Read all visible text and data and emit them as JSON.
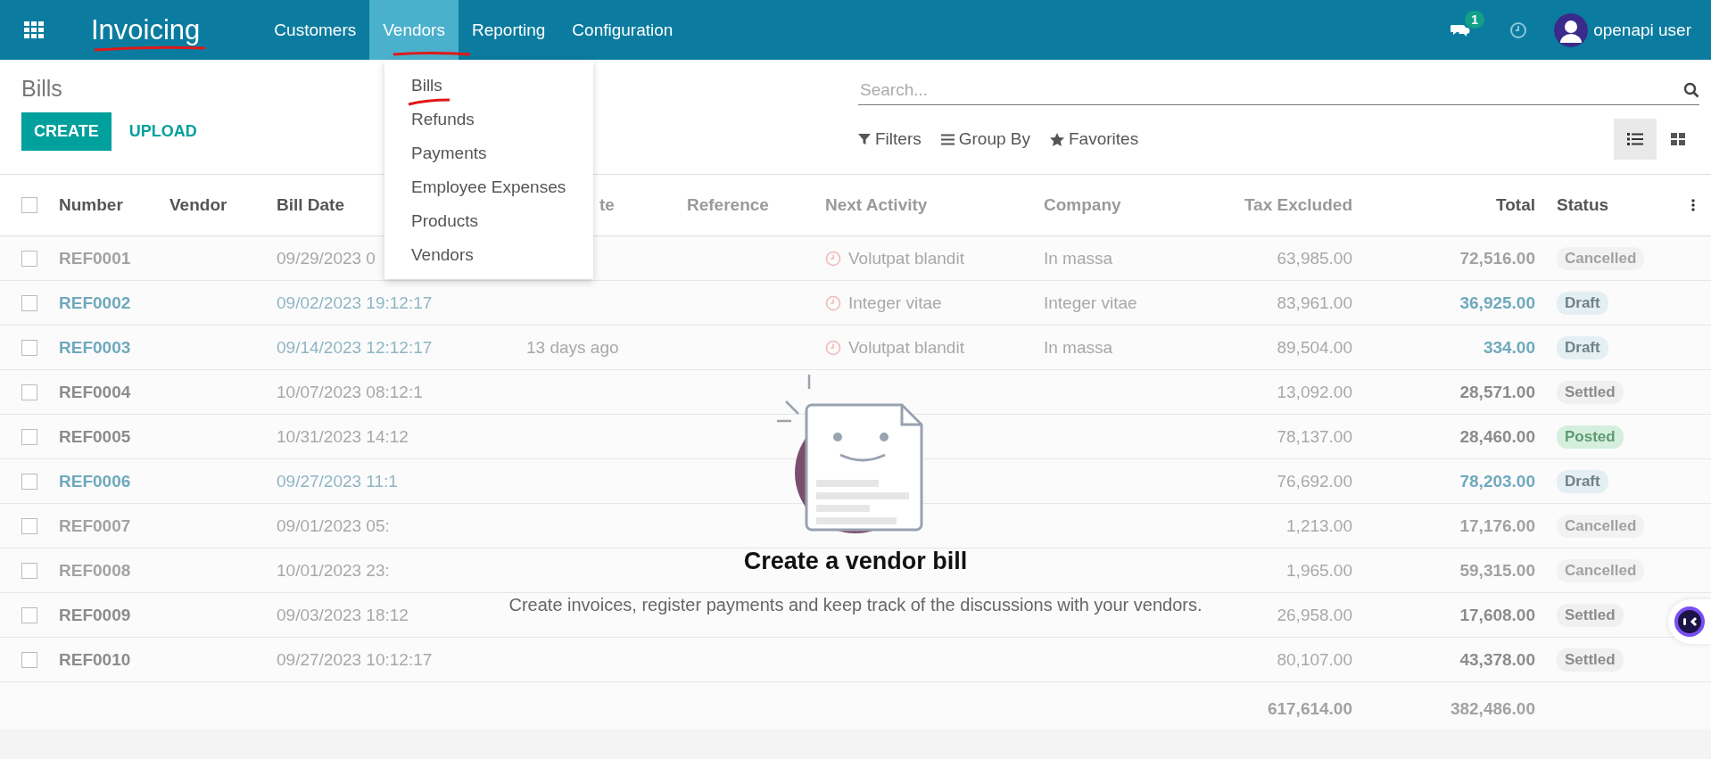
{
  "app": {
    "name": "Invoicing"
  },
  "menu": [
    {
      "label": "Customers",
      "selected": false
    },
    {
      "label": "Vendors",
      "selected": true
    },
    {
      "label": "Reporting",
      "selected": false
    },
    {
      "label": "Configuration",
      "selected": false
    }
  ],
  "user": {
    "messages_count": "1",
    "name": "openapi user"
  },
  "dropdown": [
    "Bills",
    "Refunds",
    "Payments",
    "Employee Expenses",
    "Products",
    "Vendors"
  ],
  "page": {
    "title": "Bills",
    "create": "CREATE",
    "upload": "UPLOAD"
  },
  "search": {
    "placeholder": "Search..."
  },
  "filters": [
    "Filters",
    "Group By",
    "Favorites"
  ],
  "views": [
    {
      "kind": "list",
      "selected": true
    },
    {
      "kind": "kanban",
      "selected": false
    }
  ],
  "table": {
    "select_all": {
      "checked": false
    },
    "columns": [
      "Number",
      "Vendor",
      "Bill Date",
      "te",
      "Reference",
      "Next Activity",
      "Company",
      "Tax Excluded",
      "Total",
      "Status"
    ],
    "rows": [
      {
        "checked": false,
        "number": "REF0001",
        "bill_date": "09/29/2023 0",
        "next_activity": "Volutpat blandit",
        "company": "In massa",
        "tax_excluded": "63,985.00",
        "total": "72,516.00",
        "status": "Cancelled",
        "kind": "cancelled"
      },
      {
        "checked": false,
        "number": "REF0002",
        "bill_date": "09/02/2023 19:12:17",
        "next_activity": "Integer vitae",
        "company": "Integer vitae",
        "tax_excluded": "83,961.00",
        "total": "36,925.00",
        "status": "Draft",
        "kind": "draft"
      },
      {
        "checked": false,
        "number": "REF0003",
        "bill_date": "09/14/2023 12:12:17",
        "due": "13 days ago",
        "next_activity": "Volutpat blandit",
        "company": "In massa",
        "tax_excluded": "89,504.00",
        "total": "334.00",
        "status": "Draft",
        "kind": "draft"
      },
      {
        "checked": false,
        "number": "REF0004",
        "bill_date": "10/07/2023 08:12:1",
        "tax_excluded": "13,092.00",
        "total": "28,571.00",
        "status": "Settled",
        "kind": "settled"
      },
      {
        "checked": false,
        "number": "REF0005",
        "bill_date": "10/31/2023 14:12",
        "tax_excluded": "78,137.00",
        "total": "28,460.00",
        "status": "Posted",
        "kind": "posted"
      },
      {
        "checked": false,
        "number": "REF0006",
        "bill_date": "09/27/2023 11:1",
        "tax_excluded": "76,692.00",
        "total": "78,203.00",
        "status": "Draft",
        "kind": "draft"
      },
      {
        "checked": false,
        "number": "REF0007",
        "bill_date": "09/01/2023 05:",
        "tax_excluded": "1,213.00",
        "total": "17,176.00",
        "status": "Cancelled",
        "kind": "cancelled"
      },
      {
        "checked": false,
        "number": "REF0008",
        "bill_date": "10/01/2023 23:",
        "tax_excluded": "1,965.00",
        "total": "59,315.00",
        "status": "Cancelled",
        "kind": "cancelled"
      },
      {
        "checked": false,
        "number": "REF0009",
        "bill_date": "09/03/2023 18:12",
        "tax_excluded": "26,958.00",
        "total": "17,608.00",
        "status": "Settled",
        "kind": "settled"
      },
      {
        "checked": false,
        "number": "REF0010",
        "bill_date": "09/27/2023 10:12:17",
        "tax_excluded": "80,107.00",
        "total": "43,378.00",
        "status": "Settled",
        "kind": "settled"
      }
    ],
    "footer": {
      "tax_excluded": "617,614.00",
      "total": "382,486.00"
    }
  },
  "empty_state": {
    "title": "Create a vendor bill",
    "description": "Create invoices, register payments and keep track of the discussions with your vendors."
  }
}
